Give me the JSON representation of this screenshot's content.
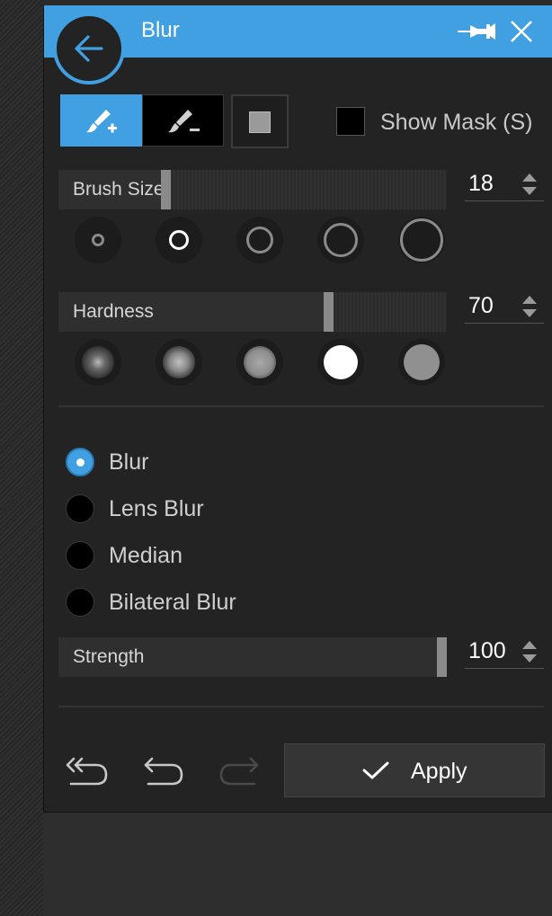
{
  "title": "Blur",
  "tools": {
    "brush_add": "brush-add-icon",
    "brush_subtract": "brush-subtract-icon",
    "mask_preview": "mask-square-icon"
  },
  "show_mask_label": "Show Mask (S)",
  "show_mask_checked": false,
  "brush_size": {
    "label": "Brush Size",
    "value": "18",
    "fraction": 0.27
  },
  "hardness": {
    "label": "Hardness",
    "value": "70",
    "fraction": 0.7
  },
  "strength": {
    "label": "Strength",
    "value": "100",
    "fraction": 1.0
  },
  "blur_types": [
    {
      "label": "Blur",
      "selected": true
    },
    {
      "label": "Lens Blur",
      "selected": false
    },
    {
      "label": "Median",
      "selected": false
    },
    {
      "label": "Bilateral Blur",
      "selected": false
    }
  ],
  "apply_label": "Apply",
  "colors": {
    "accent": "#41a0e2",
    "panel": "#232323",
    "text": "#cfcfcf"
  }
}
